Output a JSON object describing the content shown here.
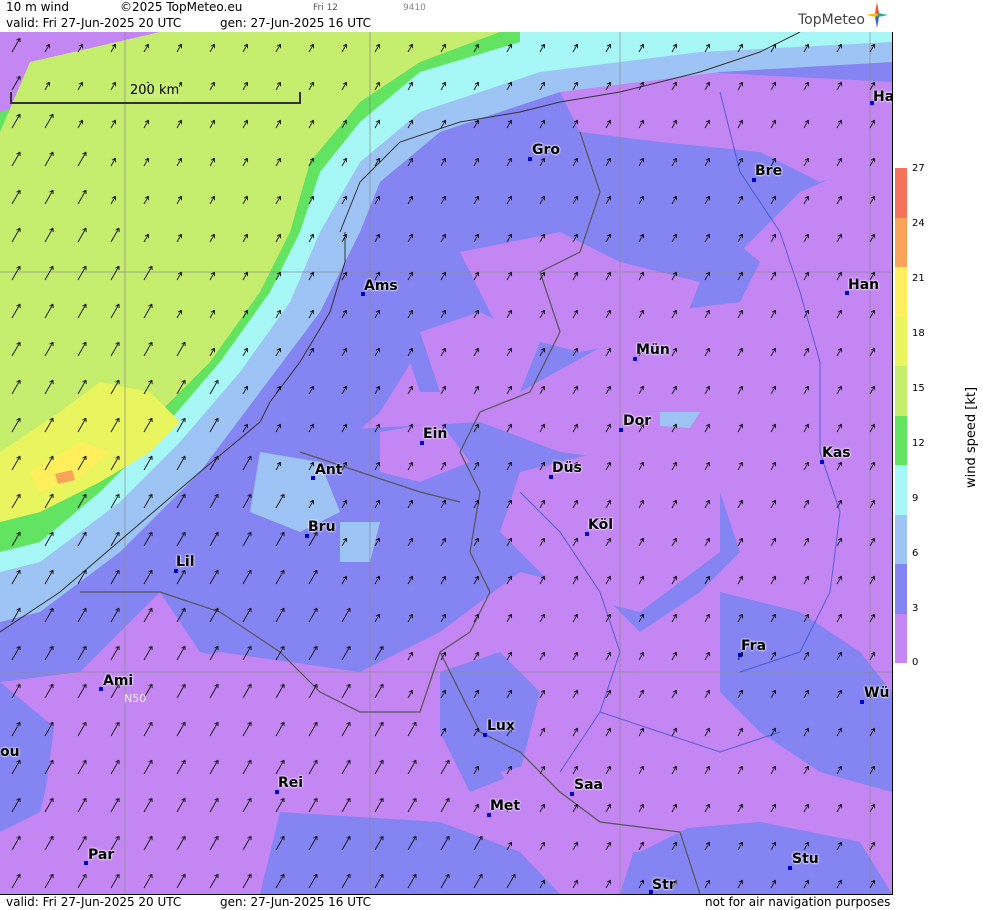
{
  "header": {
    "product": "10 m wind",
    "copyright": "©2025 TopMeteo.eu",
    "step": "Fri 12",
    "code": "9410",
    "valid": "valid:  Fri  27-Jun-2025  20 UTC",
    "gen": "gen: 27-Jun-2025 16 UTC",
    "logo": "TopMeteo"
  },
  "footer": {
    "valid": "valid:  Fri  27-Jun-2025  20 UTC",
    "gen": "gen: 27-Jun-2025 16 UTC",
    "disclaimer": "not for air navigation purposes"
  },
  "map": {
    "scale_label": "200 km",
    "lat_label": "N50",
    "cities": [
      "Ha",
      "Gro",
      "Bre",
      "Ams",
      "Han",
      "Mün",
      "Dor",
      "Ein",
      "Kas",
      "Ant",
      "Düs",
      "Köl",
      "Bru",
      "Lil",
      "Fra",
      "Ami",
      "Wü",
      "Lux",
      "ou",
      "Rei",
      "Saa",
      "Met",
      "Par",
      "Stu",
      "Str"
    ]
  },
  "legend": {
    "title": "wind speed [kt]",
    "ticks": [
      "27",
      "24",
      "21",
      "18",
      "15",
      "12",
      "9",
      "6",
      "3",
      "0"
    ],
    "colors": [
      "#f4735a",
      "#f7a35a",
      "#ffef5c",
      "#e9f55e",
      "#c5ee6e",
      "#62e362",
      "#a8f7f7",
      "#9ec4f5",
      "#8484f2",
      "#c386f3"
    ]
  }
}
